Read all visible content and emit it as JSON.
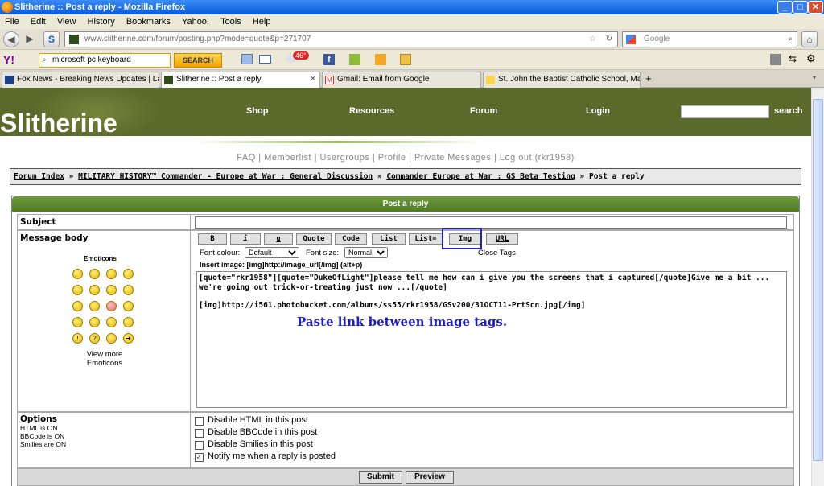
{
  "window": {
    "title": "Slitherine :: Post a reply - Mozilla Firefox"
  },
  "menu": [
    "File",
    "Edit",
    "View",
    "History",
    "Bookmarks",
    "Yahoo!",
    "Tools",
    "Help"
  ],
  "nav": {
    "url": "www.slitherine.com/forum/posting.php?mode=quote&p=271707",
    "search_placeholder": "Google"
  },
  "yahoo": {
    "search_value": "microsoft pc keyboard",
    "search_label": "SEARCH",
    "weather": "46°"
  },
  "tabs": [
    {
      "label": "Fox News - Breaking News Updates | Lat..."
    },
    {
      "label": "Slitherine :: Post a reply"
    },
    {
      "label": "Gmail: Email from Google"
    },
    {
      "label": "St. John the Baptist Catholic School, Mad..."
    }
  ],
  "site": {
    "logo": "Slitherine",
    "nav": [
      "Shop",
      "Resources",
      "Forum",
      "Login"
    ],
    "search_label": "search",
    "sublinks": "FAQ  |  Memberlist  |  Usergroups  |  Profile  |  Private Messages  |  Log out (rkr1958)"
  },
  "breadcrumb": {
    "index": "Forum Index",
    "sep": " » ",
    "cat": "MILITARY HISTORY™ Commander - Europe at War : General Discussion",
    "sub": "Commander Europe at War : GS Beta Testing",
    "current": "Post a reply"
  },
  "post": {
    "header": "Post a reply",
    "subject_label": "Subject",
    "body_label": "Message body",
    "emoticons_label": "Emoticons",
    "view_more": "View more Emoticons",
    "buttons": [
      "B",
      "i",
      "u",
      "Quote",
      "Code",
      "List",
      "List=",
      "Img",
      "URL"
    ],
    "font_colour_label": "Font colour:",
    "font_colour_value": "Default",
    "font_size_label": "Font size:",
    "font_size_value": "Normal",
    "close_tags": "Close Tags",
    "insert_image_hint": "Insert image: [img]http://image_url[/img]  (alt+p)",
    "body_line1": "[quote=\"rkr1958\"][quote=\"DukeOfLight\"]please tell me how can i give you the screens that i captured[/quote]Give me a bit ... we're going out trick-or-treating just now ...[/quote]",
    "body_line2": "[img]http://i561.photobucket.com/albums/ss55/rkr1958/GSv200/31OCT11-PrtScn.jpg[/img]",
    "annotation": "Paste link between image tags.",
    "options_label": "Options",
    "html_status": "HTML is ON",
    "bbcode_status": "BBCode is ON",
    "smilies_status": "Smilies are ON",
    "options": [
      {
        "label": "Disable HTML in this post",
        "checked": false
      },
      {
        "label": "Disable BBCode in this post",
        "checked": false
      },
      {
        "label": "Disable Smilies in this post",
        "checked": false
      },
      {
        "label": "Notify me when a reply is posted",
        "checked": true
      }
    ],
    "submit": "Submit",
    "preview": "Preview"
  }
}
